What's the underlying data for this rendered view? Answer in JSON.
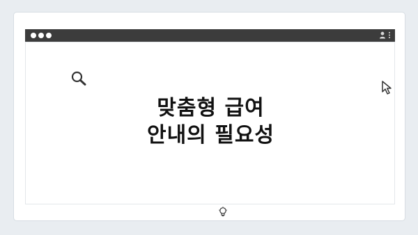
{
  "window": {
    "titlebar_color": "#3c3c3c",
    "controls": [
      "dot",
      "dot",
      "dot"
    ],
    "right_icons": [
      "user-icon",
      "more-vert-icon"
    ]
  },
  "main": {
    "headline_line1": "맞춤형 급여",
    "headline_line2": "안내의 필요성",
    "icons": [
      "search-icon",
      "cursor-arrow-icon",
      "lightbulb-icon"
    ]
  },
  "pager": {
    "dots": 4
  }
}
